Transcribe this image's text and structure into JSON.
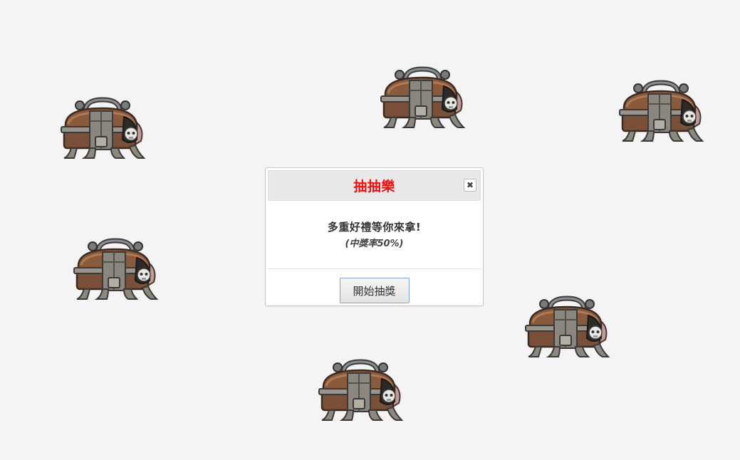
{
  "dialog": {
    "title": "抽抽樂",
    "close_icon": "close-icon",
    "main_text": "多重好禮等你來拿!",
    "sub_text": "(中獎率50%)",
    "start_button_label": "開始抽獎"
  },
  "chests": [
    {
      "icon": "treasure-chest-icon"
    },
    {
      "icon": "treasure-chest-icon"
    },
    {
      "icon": "treasure-chest-icon"
    },
    {
      "icon": "treasure-chest-icon"
    },
    {
      "icon": "treasure-chest-icon"
    },
    {
      "icon": "treasure-chest-icon"
    }
  ],
  "colors": {
    "background": "#f4f4f4",
    "title": "#ee1111",
    "button_border": "#7ea6e0"
  }
}
